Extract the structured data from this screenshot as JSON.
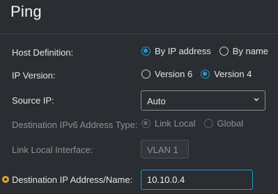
{
  "title": "Ping",
  "host_definition": {
    "label": "Host Definition:",
    "options": [
      {
        "label": "By IP address",
        "checked": true
      },
      {
        "label": "By name",
        "checked": false
      }
    ]
  },
  "ip_version": {
    "label": "IP Version:",
    "options": [
      {
        "label": "Version 6",
        "checked": false
      },
      {
        "label": "Version 4",
        "checked": true
      }
    ]
  },
  "source_ip": {
    "label": "Source IP:",
    "value": "Auto"
  },
  "dest_ipv6_type": {
    "label": "Destination IPv6 Address Type:",
    "options": [
      {
        "label": "Link Local",
        "checked": true
      },
      {
        "label": "Global",
        "checked": false
      }
    ]
  },
  "link_local_interface": {
    "label": "Link Local Interface:",
    "value": "VLAN 1"
  },
  "destination": {
    "label": "Destination IP Address/Name:",
    "value": "10.10.0.4"
  },
  "colors": {
    "background": "#2a2d31",
    "accent": "#1e9ad6",
    "required": "#e0a52b"
  }
}
